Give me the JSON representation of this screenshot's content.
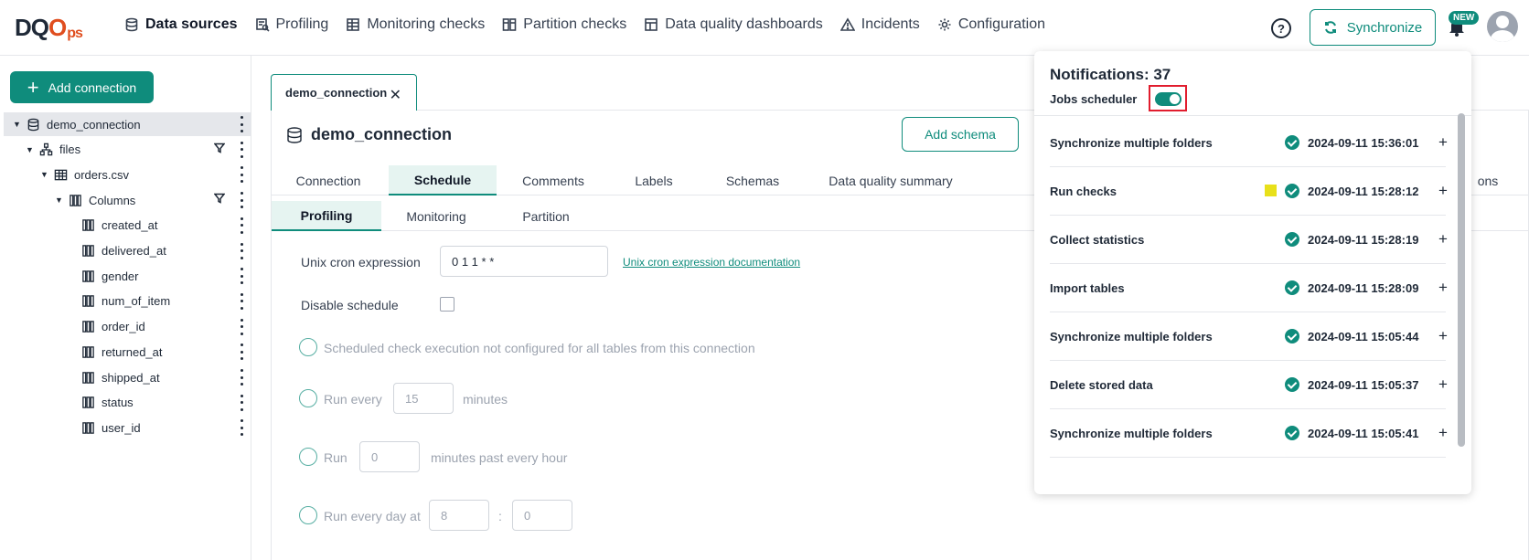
{
  "brand": {
    "logo_main": "DQO",
    "logo_suffix": "ps"
  },
  "nav": [
    {
      "label": "Data sources",
      "icon": "database-icon",
      "active": true
    },
    {
      "label": "Profiling",
      "icon": "profiling-icon"
    },
    {
      "label": "Monitoring checks",
      "icon": "monitoring-icon"
    },
    {
      "label": "Partition checks",
      "icon": "partition-icon"
    },
    {
      "label": "Data quality dashboards",
      "icon": "dashboard-icon"
    },
    {
      "label": "Incidents",
      "icon": "warning-icon"
    },
    {
      "label": "Configuration",
      "icon": "gear-icon"
    }
  ],
  "header": {
    "sync_label": "Synchronize",
    "new_badge": "NEW",
    "help_glyph": "?"
  },
  "sidebar": {
    "add_connection_label": "Add connection",
    "tree": [
      {
        "label": "demo_connection",
        "level": 0,
        "icon": "database-icon",
        "selected": true
      },
      {
        "label": "files",
        "level": 1,
        "icon": "schema-icon",
        "filter": true
      },
      {
        "label": "orders.csv",
        "level": 2,
        "icon": "table-icon"
      },
      {
        "label": "Columns",
        "level": 3,
        "icon": "columns-icon",
        "filter": true
      },
      {
        "label": "created_at",
        "level": 4,
        "icon": "column-icon"
      },
      {
        "label": "delivered_at",
        "level": 4,
        "icon": "column-icon"
      },
      {
        "label": "gender",
        "level": 4,
        "icon": "column-icon"
      },
      {
        "label": "num_of_item",
        "level": 4,
        "icon": "column-icon"
      },
      {
        "label": "order_id",
        "level": 4,
        "icon": "column-icon"
      },
      {
        "label": "returned_at",
        "level": 4,
        "icon": "column-icon"
      },
      {
        "label": "shipped_at",
        "level": 4,
        "icon": "column-icon"
      },
      {
        "label": "status",
        "level": 4,
        "icon": "column-icon"
      },
      {
        "label": "user_id",
        "level": 4,
        "icon": "column-icon"
      }
    ]
  },
  "main": {
    "doc_tab": "demo_connection",
    "title": "demo_connection",
    "add_schema_label": "Add schema",
    "tabs": [
      "Connection",
      "Schedule",
      "Comments",
      "Labels",
      "Schemas",
      "Data quality summary"
    ],
    "tabs_right_fragment": "ons",
    "subtabs": [
      "Profiling",
      "Monitoring",
      "Partition"
    ],
    "cron_label": "Unix cron expression",
    "cron_value": "0 1 1 * *",
    "cron_doc_link": "Unix cron expression documentation",
    "disable_label": "Disable schedule",
    "opt_not_configured": "Scheduled check execution not configured for all tables from this connection",
    "opt_run_every": "Run every",
    "opt_run_every_value": "15",
    "opt_run_every_unit": "minutes",
    "opt_run": "Run",
    "opt_run_value": "0",
    "opt_run_unit": "minutes past every hour",
    "opt_run_day": "Run every day at",
    "opt_run_day_hour": "8",
    "opt_run_day_sep": ":",
    "opt_run_day_min": "0"
  },
  "notifications": {
    "title": "Notifications: 37",
    "jobs_scheduler_label": "Jobs scheduler",
    "jobs_scheduler_on": true,
    "items": [
      {
        "label": "Synchronize multiple folders",
        "timestamp": "2024-09-11 15:36:01",
        "status": "success",
        "warning": false
      },
      {
        "label": "Run checks",
        "timestamp": "2024-09-11 15:28:12",
        "status": "success",
        "warning": true
      },
      {
        "label": "Collect statistics",
        "timestamp": "2024-09-11 15:28:19",
        "status": "success",
        "warning": false
      },
      {
        "label": "Import tables",
        "timestamp": "2024-09-11 15:28:09",
        "status": "success",
        "warning": false
      },
      {
        "label": "Synchronize multiple folders",
        "timestamp": "2024-09-11 15:05:44",
        "status": "success",
        "warning": false
      },
      {
        "label": "Delete stored data",
        "timestamp": "2024-09-11 15:05:37",
        "status": "success",
        "warning": false
      },
      {
        "label": "Synchronize multiple folders",
        "timestamp": "2024-09-11 15:05:41",
        "status": "success",
        "warning": false
      }
    ],
    "expand_glyph": "+"
  },
  "colors": {
    "accent": "#0f8c7c",
    "highlight_box": "#e11d2e",
    "warning": "#e8e01a"
  }
}
